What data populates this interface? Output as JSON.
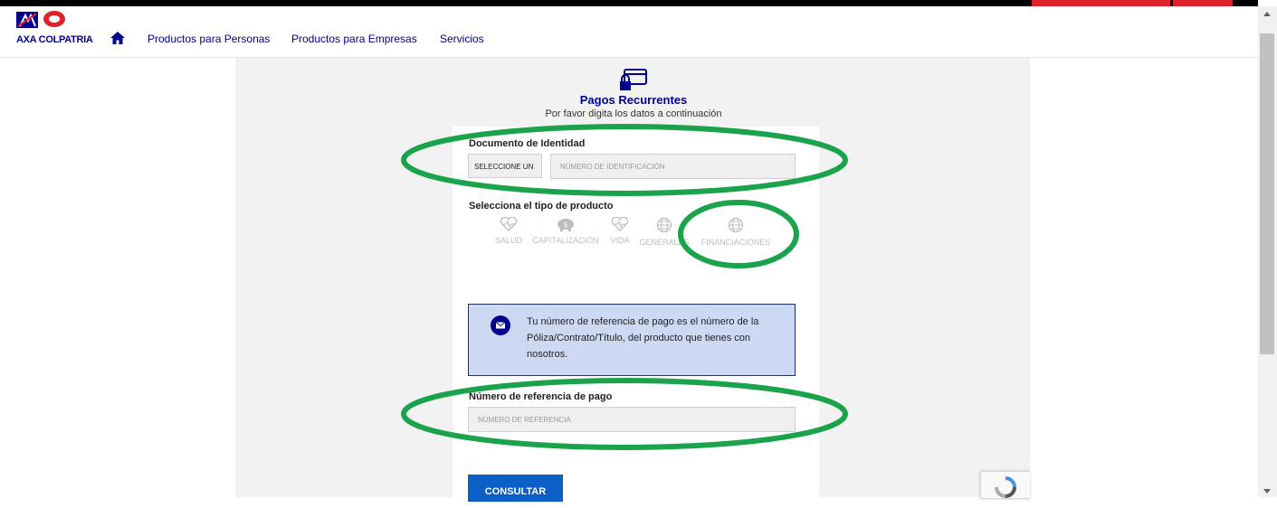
{
  "brand": {
    "name": "AXA COLPATRIA",
    "primary": "#00008f",
    "accent": "#e0212b"
  },
  "nav": {
    "items": [
      "Productos para Personas",
      "Productos para Empresas",
      "Servicios"
    ]
  },
  "form": {
    "title": "Pagos Recurrentes",
    "subtitle": "Por favor digita los datos a continuación",
    "document_label": "Documento de Identidad",
    "select_value": "SELECCIONE UN",
    "id_placeholder": "NÚMERO DE IDENTIFICACIÓN",
    "product_label": "Selecciona el tipo de producto",
    "products": [
      {
        "name": "SALUD",
        "icon": "heart-pulse-icon"
      },
      {
        "name": "CAPITALIZACIÓN",
        "icon": "piggy-bank-icon"
      },
      {
        "name": "VIDA",
        "icon": "heart-pulse-icon"
      },
      {
        "name": "GENERALES",
        "icon": "globe-icon"
      },
      {
        "name": "FINANCIACIONES",
        "icon": "globe-icon"
      }
    ],
    "info_text": "Tu número de referencia de pago es el número de la Póliza/Contrato/Título, del producto que tienes con nosotros.",
    "reference_label": "Número de referencia de pago",
    "reference_placeholder": "NÚMERO DE REFERENCIA",
    "submit_label": "CONSULTAR"
  },
  "annotation_color": "#1aa34a"
}
